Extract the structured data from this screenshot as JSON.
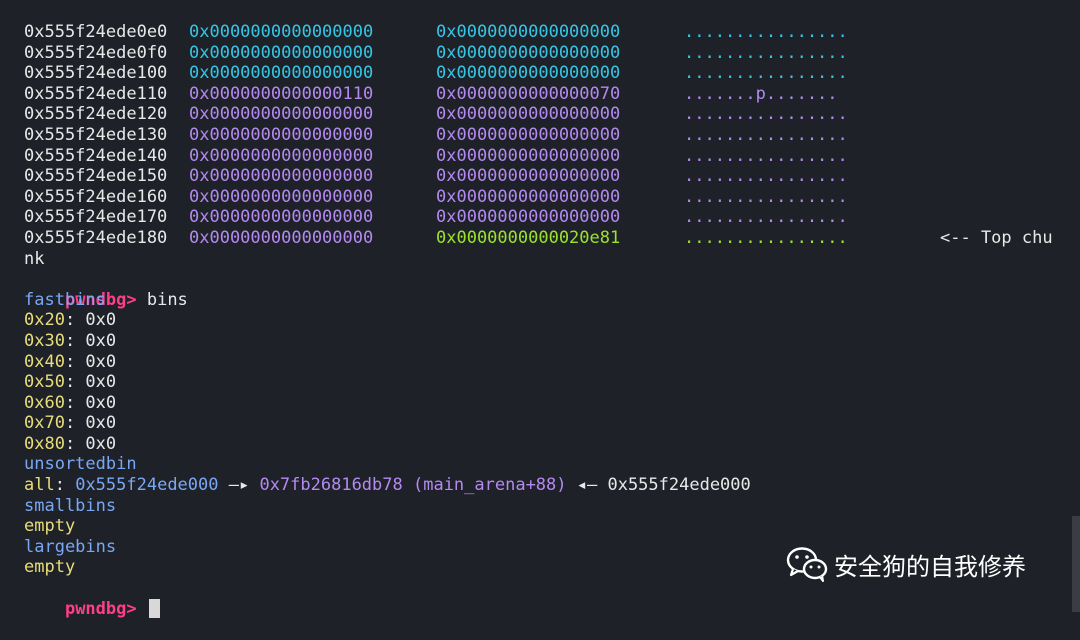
{
  "colors": {
    "background": "#1e2228",
    "cyan": "#35c6e6",
    "purple": "#b489f0",
    "green": "#9be22e",
    "prompt": "#ff3d8a",
    "heading": "#7aa7f4",
    "yellow": "#e7dd7a"
  },
  "memory_rows": [
    {
      "addr": "0x555f24ede0e0",
      "q1": "0x0000000000000000",
      "q2": "0x0000000000000000",
      "ascii": "................",
      "style": "cyan"
    },
    {
      "addr": "0x555f24ede0f0",
      "q1": "0x0000000000000000",
      "q2": "0x0000000000000000",
      "ascii": "................",
      "style": "cyan"
    },
    {
      "addr": "0x555f24ede100",
      "q1": "0x0000000000000000",
      "q2": "0x0000000000000000",
      "ascii": "................",
      "style": "cyan"
    },
    {
      "addr": "0x555f24ede110",
      "q1": "0x0000000000000110",
      "q2": "0x0000000000000070",
      "ascii": ".......p.......",
      "style": "purple"
    },
    {
      "addr": "0x555f24ede120",
      "q1": "0x0000000000000000",
      "q2": "0x0000000000000000",
      "ascii": "................",
      "style": "purple"
    },
    {
      "addr": "0x555f24ede130",
      "q1": "0x0000000000000000",
      "q2": "0x0000000000000000",
      "ascii": "................",
      "style": "purple"
    },
    {
      "addr": "0x555f24ede140",
      "q1": "0x0000000000000000",
      "q2": "0x0000000000000000",
      "ascii": "................",
      "style": "purple"
    },
    {
      "addr": "0x555f24ede150",
      "q1": "0x0000000000000000",
      "q2": "0x0000000000000000",
      "ascii": "................",
      "style": "purple"
    },
    {
      "addr": "0x555f24ede160",
      "q1": "0x0000000000000000",
      "q2": "0x0000000000000000",
      "ascii": "................",
      "style": "purple"
    },
    {
      "addr": "0x555f24ede170",
      "q1": "0x0000000000000000",
      "q2": "0x0000000000000000",
      "ascii": "................",
      "style": "purple"
    }
  ],
  "top_row": {
    "addr": "0x555f24ede180",
    "q1": "0x0000000000000000",
    "q2": "0x0000000000020e81",
    "ascii": "................",
    "note": "<-- Top chu",
    "note_wrap": "nk"
  },
  "prompt": "pwndbg>",
  "command": " bins",
  "fastbins": {
    "heading": "fastbins",
    "entries": [
      {
        "size": "0x20",
        "value": ": 0x0"
      },
      {
        "size": "0x30",
        "value": ": 0x0"
      },
      {
        "size": "0x40",
        "value": ": 0x0"
      },
      {
        "size": "0x50",
        "value": ": 0x0"
      },
      {
        "size": "0x60",
        "value": ": 0x0"
      },
      {
        "size": "0x70",
        "value": ": 0x0"
      },
      {
        "size": "0x80",
        "value": ": 0x0"
      }
    ]
  },
  "unsortedbin": {
    "heading": "unsortedbin",
    "label": "all",
    "colon": ": ",
    "chunk": "0x555f24ede000",
    "arrow_fwd": " —▸ ",
    "arena_addr": "0x7fb26816db78",
    "arena_sym": " (main_arena+88)",
    "arrow_back": " ◂— ",
    "back_chunk": "0x555f24ede000"
  },
  "smallbins": {
    "heading": "smallbins",
    "value": "empty"
  },
  "largebins": {
    "heading": "largebins",
    "value": "empty"
  },
  "final_prompt": "pwndbg>",
  "watermark": {
    "text": "安全狗的自我修养",
    "icon": "wechat-icon"
  }
}
